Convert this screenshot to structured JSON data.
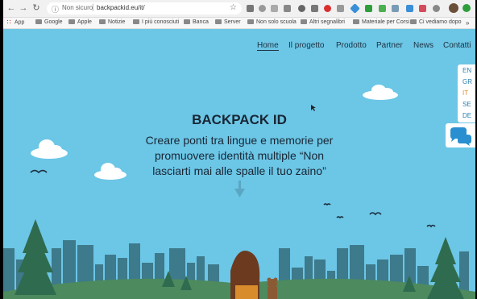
{
  "browser": {
    "security_label": "Non sicuro",
    "url": "backpackid.eu/it/"
  },
  "bookmarks": [
    {
      "label": "App",
      "icon": "apps-icon"
    },
    {
      "label": "Google",
      "icon": "folder-icon"
    },
    {
      "label": "Apple",
      "icon": "folder-icon"
    },
    {
      "label": "Notizie",
      "icon": "folder-icon"
    },
    {
      "label": "I più conosciuti",
      "icon": "folder-icon"
    },
    {
      "label": "Banca",
      "icon": "folder-icon"
    },
    {
      "label": "Server",
      "icon": "folder-icon"
    },
    {
      "label": "Non solo scuola",
      "icon": "folder-icon"
    },
    {
      "label": "Altri segnalibri",
      "icon": "folder-icon"
    },
    {
      "label": "Materiale per Corsi",
      "icon": "folder-icon"
    },
    {
      "label": "Ci vediamo dopo",
      "icon": "folder-icon"
    }
  ],
  "nav": {
    "items": [
      "Home",
      "Il progetto",
      "Prodotto",
      "Partner",
      "News",
      "Contatti"
    ],
    "active": "Home"
  },
  "languages": {
    "items": [
      "EN",
      "GR",
      "IT",
      "SE",
      "DE"
    ],
    "current": "IT"
  },
  "hero": {
    "title": "BACKPACK ID",
    "subtitle_lines": [
      "Creare ponti tra lingue e memorie per",
      "promuovere identità multiple “Non",
      "lasciarti mai alle spalle il tuo zaino”"
    ]
  },
  "colors": {
    "sky": "#6cc6e6",
    "city": "#3d7a8c",
    "tree": "#2f6b4f",
    "text": "#182634",
    "lang_current": "#e58a2b",
    "lang_link": "#2a7fb0"
  }
}
